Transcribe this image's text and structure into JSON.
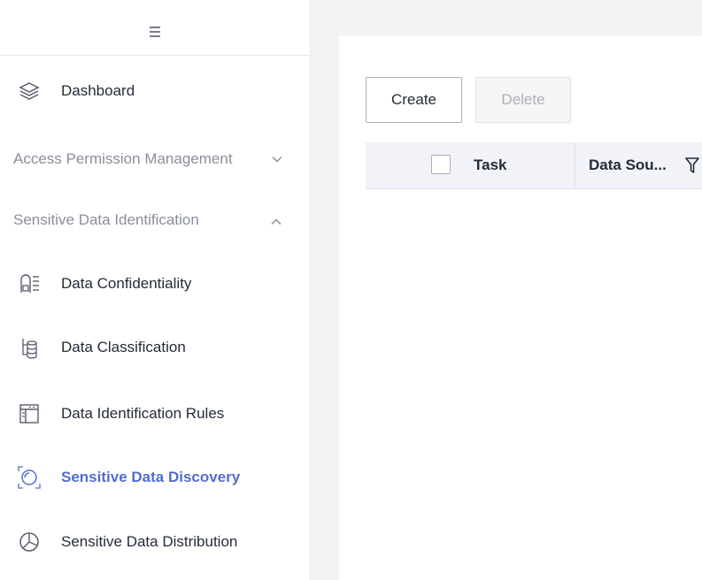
{
  "sidebar": {
    "toggle_icon": "menu-lines-icon",
    "items": [
      {
        "label": "Dashboard",
        "icon": "layers-icon"
      },
      {
        "label": "Access Permission Management",
        "icon": "chevron-down-icon"
      },
      {
        "label": "Sensitive Data Identification",
        "icon": "chevron-up-icon"
      },
      {
        "label": "Data Confidentiality",
        "icon": "document-list-icon"
      },
      {
        "label": "Data Classification",
        "icon": "database-stack-icon"
      },
      {
        "label": "Data Identification Rules",
        "icon": "rules-table-icon"
      },
      {
        "label": "Sensitive Data Discovery",
        "icon": "scan-eye-icon",
        "active": true
      },
      {
        "label": "Sensitive Data Distribution",
        "icon": "pie-chart-icon"
      }
    ]
  },
  "toolbar": {
    "create_label": "Create",
    "delete_label": "Delete"
  },
  "table": {
    "columns": [
      "Task",
      "Data Sou..."
    ],
    "filter_icon": "filter-icon"
  },
  "colors": {
    "accent": "#526ecc",
    "background": "#f2f3f5",
    "text": "#252b3a",
    "muted": "#8a8e99"
  }
}
